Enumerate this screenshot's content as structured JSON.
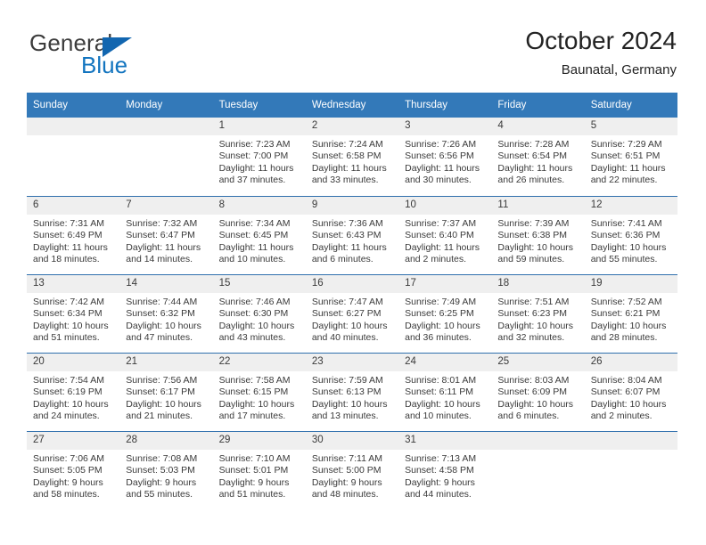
{
  "brand": {
    "name_top": "General",
    "name_bottom": "Blue",
    "accent_color": "#1274bf"
  },
  "header": {
    "title": "October 2024",
    "subtitle": "Baunatal, Germany"
  },
  "theme": {
    "header_row_bg": "#3379b9",
    "week_divider": "#2f6fad",
    "daynum_bg": "#efefef",
    "text": "#3a3a3a"
  },
  "labels": {
    "sunrise": "Sunrise:",
    "sunset": "Sunset:",
    "daylight": "Daylight:"
  },
  "weekdays": [
    "Sunday",
    "Monday",
    "Tuesday",
    "Wednesday",
    "Thursday",
    "Friday",
    "Saturday"
  ],
  "weeks": [
    [
      {
        "day": "",
        "sunrise": "",
        "sunset": "",
        "daylight": ""
      },
      {
        "day": "",
        "sunrise": "",
        "sunset": "",
        "daylight": ""
      },
      {
        "day": "1",
        "sunrise": "Sunrise: 7:23 AM",
        "sunset": "Sunset: 7:00 PM",
        "daylight": "Daylight: 11 hours and 37 minutes."
      },
      {
        "day": "2",
        "sunrise": "Sunrise: 7:24 AM",
        "sunset": "Sunset: 6:58 PM",
        "daylight": "Daylight: 11 hours and 33 minutes."
      },
      {
        "day": "3",
        "sunrise": "Sunrise: 7:26 AM",
        "sunset": "Sunset: 6:56 PM",
        "daylight": "Daylight: 11 hours and 30 minutes."
      },
      {
        "day": "4",
        "sunrise": "Sunrise: 7:28 AM",
        "sunset": "Sunset: 6:54 PM",
        "daylight": "Daylight: 11 hours and 26 minutes."
      },
      {
        "day": "5",
        "sunrise": "Sunrise: 7:29 AM",
        "sunset": "Sunset: 6:51 PM",
        "daylight": "Daylight: 11 hours and 22 minutes."
      }
    ],
    [
      {
        "day": "6",
        "sunrise": "Sunrise: 7:31 AM",
        "sunset": "Sunset: 6:49 PM",
        "daylight": "Daylight: 11 hours and 18 minutes."
      },
      {
        "day": "7",
        "sunrise": "Sunrise: 7:32 AM",
        "sunset": "Sunset: 6:47 PM",
        "daylight": "Daylight: 11 hours and 14 minutes."
      },
      {
        "day": "8",
        "sunrise": "Sunrise: 7:34 AM",
        "sunset": "Sunset: 6:45 PM",
        "daylight": "Daylight: 11 hours and 10 minutes."
      },
      {
        "day": "9",
        "sunrise": "Sunrise: 7:36 AM",
        "sunset": "Sunset: 6:43 PM",
        "daylight": "Daylight: 11 hours and 6 minutes."
      },
      {
        "day": "10",
        "sunrise": "Sunrise: 7:37 AM",
        "sunset": "Sunset: 6:40 PM",
        "daylight": "Daylight: 11 hours and 2 minutes."
      },
      {
        "day": "11",
        "sunrise": "Sunrise: 7:39 AM",
        "sunset": "Sunset: 6:38 PM",
        "daylight": "Daylight: 10 hours and 59 minutes."
      },
      {
        "day": "12",
        "sunrise": "Sunrise: 7:41 AM",
        "sunset": "Sunset: 6:36 PM",
        "daylight": "Daylight: 10 hours and 55 minutes."
      }
    ],
    [
      {
        "day": "13",
        "sunrise": "Sunrise: 7:42 AM",
        "sunset": "Sunset: 6:34 PM",
        "daylight": "Daylight: 10 hours and 51 minutes."
      },
      {
        "day": "14",
        "sunrise": "Sunrise: 7:44 AM",
        "sunset": "Sunset: 6:32 PM",
        "daylight": "Daylight: 10 hours and 47 minutes."
      },
      {
        "day": "15",
        "sunrise": "Sunrise: 7:46 AM",
        "sunset": "Sunset: 6:30 PM",
        "daylight": "Daylight: 10 hours and 43 minutes."
      },
      {
        "day": "16",
        "sunrise": "Sunrise: 7:47 AM",
        "sunset": "Sunset: 6:27 PM",
        "daylight": "Daylight: 10 hours and 40 minutes."
      },
      {
        "day": "17",
        "sunrise": "Sunrise: 7:49 AM",
        "sunset": "Sunset: 6:25 PM",
        "daylight": "Daylight: 10 hours and 36 minutes."
      },
      {
        "day": "18",
        "sunrise": "Sunrise: 7:51 AM",
        "sunset": "Sunset: 6:23 PM",
        "daylight": "Daylight: 10 hours and 32 minutes."
      },
      {
        "day": "19",
        "sunrise": "Sunrise: 7:52 AM",
        "sunset": "Sunset: 6:21 PM",
        "daylight": "Daylight: 10 hours and 28 minutes."
      }
    ],
    [
      {
        "day": "20",
        "sunrise": "Sunrise: 7:54 AM",
        "sunset": "Sunset: 6:19 PM",
        "daylight": "Daylight: 10 hours and 24 minutes."
      },
      {
        "day": "21",
        "sunrise": "Sunrise: 7:56 AM",
        "sunset": "Sunset: 6:17 PM",
        "daylight": "Daylight: 10 hours and 21 minutes."
      },
      {
        "day": "22",
        "sunrise": "Sunrise: 7:58 AM",
        "sunset": "Sunset: 6:15 PM",
        "daylight": "Daylight: 10 hours and 17 minutes."
      },
      {
        "day": "23",
        "sunrise": "Sunrise: 7:59 AM",
        "sunset": "Sunset: 6:13 PM",
        "daylight": "Daylight: 10 hours and 13 minutes."
      },
      {
        "day": "24",
        "sunrise": "Sunrise: 8:01 AM",
        "sunset": "Sunset: 6:11 PM",
        "daylight": "Daylight: 10 hours and 10 minutes."
      },
      {
        "day": "25",
        "sunrise": "Sunrise: 8:03 AM",
        "sunset": "Sunset: 6:09 PM",
        "daylight": "Daylight: 10 hours and 6 minutes."
      },
      {
        "day": "26",
        "sunrise": "Sunrise: 8:04 AM",
        "sunset": "Sunset: 6:07 PM",
        "daylight": "Daylight: 10 hours and 2 minutes."
      }
    ],
    [
      {
        "day": "27",
        "sunrise": "Sunrise: 7:06 AM",
        "sunset": "Sunset: 5:05 PM",
        "daylight": "Daylight: 9 hours and 58 minutes."
      },
      {
        "day": "28",
        "sunrise": "Sunrise: 7:08 AM",
        "sunset": "Sunset: 5:03 PM",
        "daylight": "Daylight: 9 hours and 55 minutes."
      },
      {
        "day": "29",
        "sunrise": "Sunrise: 7:10 AM",
        "sunset": "Sunset: 5:01 PM",
        "daylight": "Daylight: 9 hours and 51 minutes."
      },
      {
        "day": "30",
        "sunrise": "Sunrise: 7:11 AM",
        "sunset": "Sunset: 5:00 PM",
        "daylight": "Daylight: 9 hours and 48 minutes."
      },
      {
        "day": "31",
        "sunrise": "Sunrise: 7:13 AM",
        "sunset": "Sunset: 4:58 PM",
        "daylight": "Daylight: 9 hours and 44 minutes."
      },
      {
        "day": "",
        "sunrise": "",
        "sunset": "",
        "daylight": ""
      },
      {
        "day": "",
        "sunrise": "",
        "sunset": "",
        "daylight": ""
      }
    ]
  ]
}
